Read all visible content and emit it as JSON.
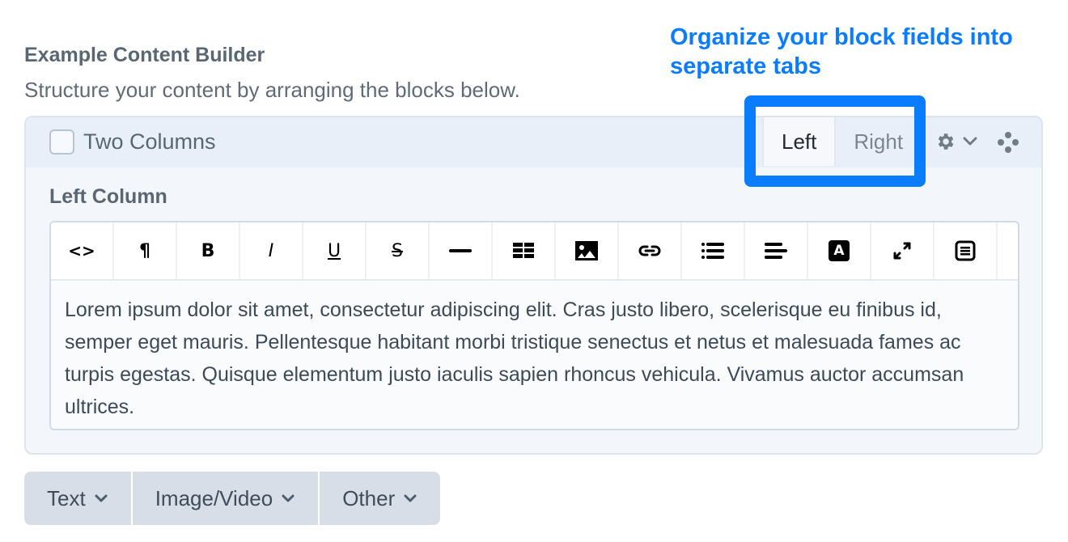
{
  "field": {
    "label": "Example Content Builder",
    "instructions": "Structure your content by arranging the blocks below."
  },
  "annotation": {
    "text": "Organize your block fields into separate tabs",
    "color": "#0a7cff"
  },
  "block": {
    "title": "Two Columns",
    "checked": false,
    "tabs": [
      {
        "label": "Left",
        "active": true
      },
      {
        "label": "Right",
        "active": false
      }
    ],
    "settings_icon": "gear-icon",
    "settings_chevron": "chevron-down-icon",
    "move_icon": "move-handle-icon",
    "column_label": "Left Column",
    "editor": {
      "toolbar": [
        {
          "name": "html",
          "icon": "code-icon",
          "glyph": "<>"
        },
        {
          "name": "format",
          "icon": "paragraph-icon",
          "glyph": "¶"
        },
        {
          "name": "bold",
          "icon": "bold-icon",
          "glyph": "B"
        },
        {
          "name": "italic",
          "icon": "italic-icon",
          "glyph": "I"
        },
        {
          "name": "underline",
          "icon": "underline-icon",
          "glyph": "U"
        },
        {
          "name": "strikethrough",
          "icon": "strikethrough-icon",
          "glyph": "S"
        },
        {
          "name": "horizontal-rule",
          "icon": "horizontal-rule-icon",
          "glyph": ""
        },
        {
          "name": "table",
          "icon": "table-icon",
          "glyph": ""
        },
        {
          "name": "image",
          "icon": "image-icon",
          "glyph": ""
        },
        {
          "name": "link",
          "icon": "link-icon",
          "glyph": ""
        },
        {
          "name": "lists",
          "icon": "list-icon",
          "glyph": ""
        },
        {
          "name": "alignment",
          "icon": "align-icon",
          "glyph": ""
        },
        {
          "name": "font-color",
          "icon": "font-color-icon",
          "glyph": "A"
        },
        {
          "name": "fullscreen",
          "icon": "expand-icon",
          "glyph": ""
        },
        {
          "name": "source",
          "icon": "document-icon",
          "glyph": ""
        }
      ],
      "content": "Lorem ipsum dolor sit amet, consectetur adipiscing elit. Cras justo libero, scelerisque eu finibus id, semper eget mauris. Pellentesque habitant morbi tristique senectus et netus et malesuada fames ac turpis egestas. Quisque elementum justo iaculis sapien rhoncus vehicula. Vivamus auctor accumsan ultrices."
    }
  },
  "add_buttons": [
    {
      "label": "Text"
    },
    {
      "label": "Image/Video"
    },
    {
      "label": "Other"
    }
  ]
}
